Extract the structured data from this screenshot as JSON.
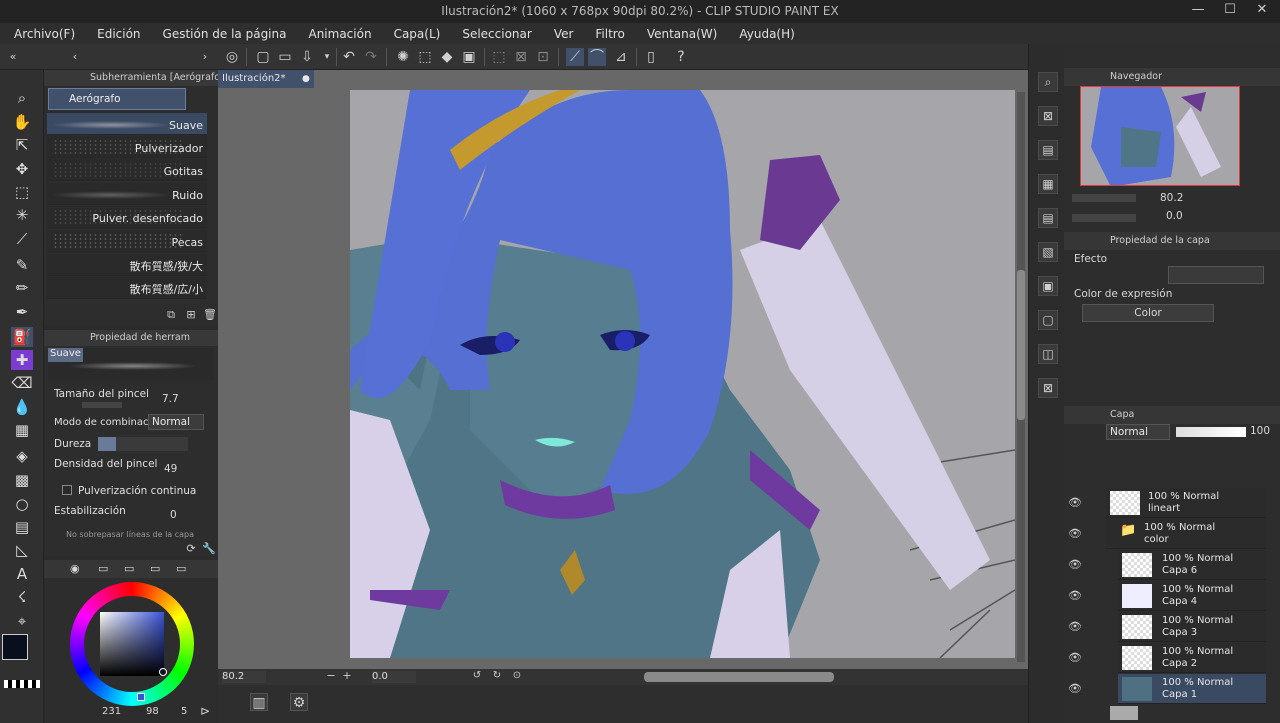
{
  "window": {
    "title": "Ilustración2* (1060 x 768px 90dpi 80.2%)  - CLIP STUDIO PAINT EX",
    "minimize": "—",
    "maximize": "☐",
    "close": "✕"
  },
  "menu": [
    "Archivo(F)",
    "Edición",
    "Gestión de la página",
    "Animación",
    "Capa(L)",
    "Seleccionar",
    "Ver",
    "Filtro",
    "Ventana(W)",
    "Ayuda(H)"
  ],
  "subtool": {
    "header": "Subherramienta [Aerógrafo]",
    "group": "Aerógrafo",
    "brushes": [
      "Suave",
      "Pulverizador",
      "Gotitas",
      "Ruido",
      "Pulver. desenfocado",
      "Pecas",
      "散布質感/狭/大",
      "散布質感/広/小"
    ]
  },
  "toolprop": {
    "header": "Propiedad de herram",
    "preview_label": "Suave",
    "size_label": "Tamaño del pincel",
    "size_value": "7.7",
    "blend_label": "Modo de combinación",
    "blend_value": "Normal",
    "hardness_label": "Dureza",
    "density_label": "Densidad del pincel",
    "density_value": "49",
    "continuous_label": "Pulverización continua",
    "stabil_label": "Estabilización",
    "stabil_value": "0",
    "cut_label": "No sobrepasar líneas de la capa"
  },
  "color": {
    "main_hex": "#0a0f1e",
    "sub_hex": "#9aa0a8",
    "r": "231",
    "g": "98",
    "b": "5"
  },
  "document": {
    "tab_label": "Ilustración2*",
    "zoom": "80.2",
    "angle": "0.0"
  },
  "navigator": {
    "header": "Navegador",
    "zoom": "80.2",
    "rotate": "0.0"
  },
  "layerprop": {
    "header": "Propiedad de la capa",
    "effect_label": "Efecto",
    "expr_label": "Color de expresión",
    "expr_value": "Color"
  },
  "layers": {
    "header": "Capa",
    "blend": "Normal",
    "opacity": "100",
    "items": [
      {
        "pct": "100 % Normal",
        "name": "lineart",
        "folder": false,
        "indent": false,
        "sel": false
      },
      {
        "pct": "100 % Normal",
        "name": "color",
        "folder": true,
        "indent": false,
        "sel": false
      },
      {
        "pct": "100 % Normal",
        "name": "Capa 6",
        "folder": false,
        "indent": true,
        "sel": false
      },
      {
        "pct": "100 % Normal",
        "name": "Capa 4",
        "folder": false,
        "indent": true,
        "sel": false
      },
      {
        "pct": "100 % Normal",
        "name": "Capa 3",
        "folder": false,
        "indent": true,
        "sel": false
      },
      {
        "pct": "100 % Normal",
        "name": "Capa 2",
        "folder": false,
        "indent": true,
        "sel": false
      },
      {
        "pct": "100 % Normal",
        "name": "Capa 1",
        "folder": false,
        "indent": true,
        "sel": true
      }
    ]
  },
  "icons": {
    "search": "search-icon",
    "hand": "hand-icon",
    "move": "move-icon",
    "brush": "airbrush-icon",
    "eraser": "eraser-icon",
    "eye": "eye-icon",
    "folder": "folder-icon"
  }
}
